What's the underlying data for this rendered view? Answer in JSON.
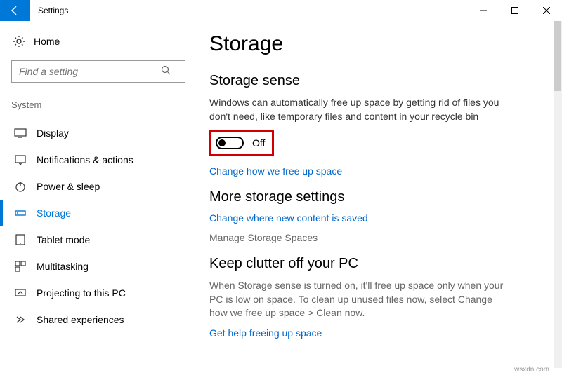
{
  "window": {
    "title": "Settings"
  },
  "sidebar": {
    "home": "Home",
    "searchPlaceholder": "Find a setting",
    "category": "System",
    "items": [
      {
        "label": "Display"
      },
      {
        "label": "Notifications & actions"
      },
      {
        "label": "Power & sleep"
      },
      {
        "label": "Storage"
      },
      {
        "label": "Tablet mode"
      },
      {
        "label": "Multitasking"
      },
      {
        "label": "Projecting to this PC"
      },
      {
        "label": "Shared experiences"
      }
    ]
  },
  "main": {
    "title": "Storage",
    "sense": {
      "heading": "Storage sense",
      "desc": "Windows can automatically free up space by getting rid of files you don't need, like temporary files and content in your recycle bin",
      "toggleLabel": "Off",
      "link": "Change how we free up space"
    },
    "more": {
      "heading": "More storage settings",
      "link1": "Change where new content is saved",
      "link2": "Manage Storage Spaces"
    },
    "clutter": {
      "heading": "Keep clutter off your PC",
      "desc": "When Storage sense is turned on, it'll free up space only when your PC is low on space. To clean up unused files now, select Change how we free up space > Clean now.",
      "link": "Get help freeing up space"
    }
  },
  "watermark": "wsxdn.com"
}
